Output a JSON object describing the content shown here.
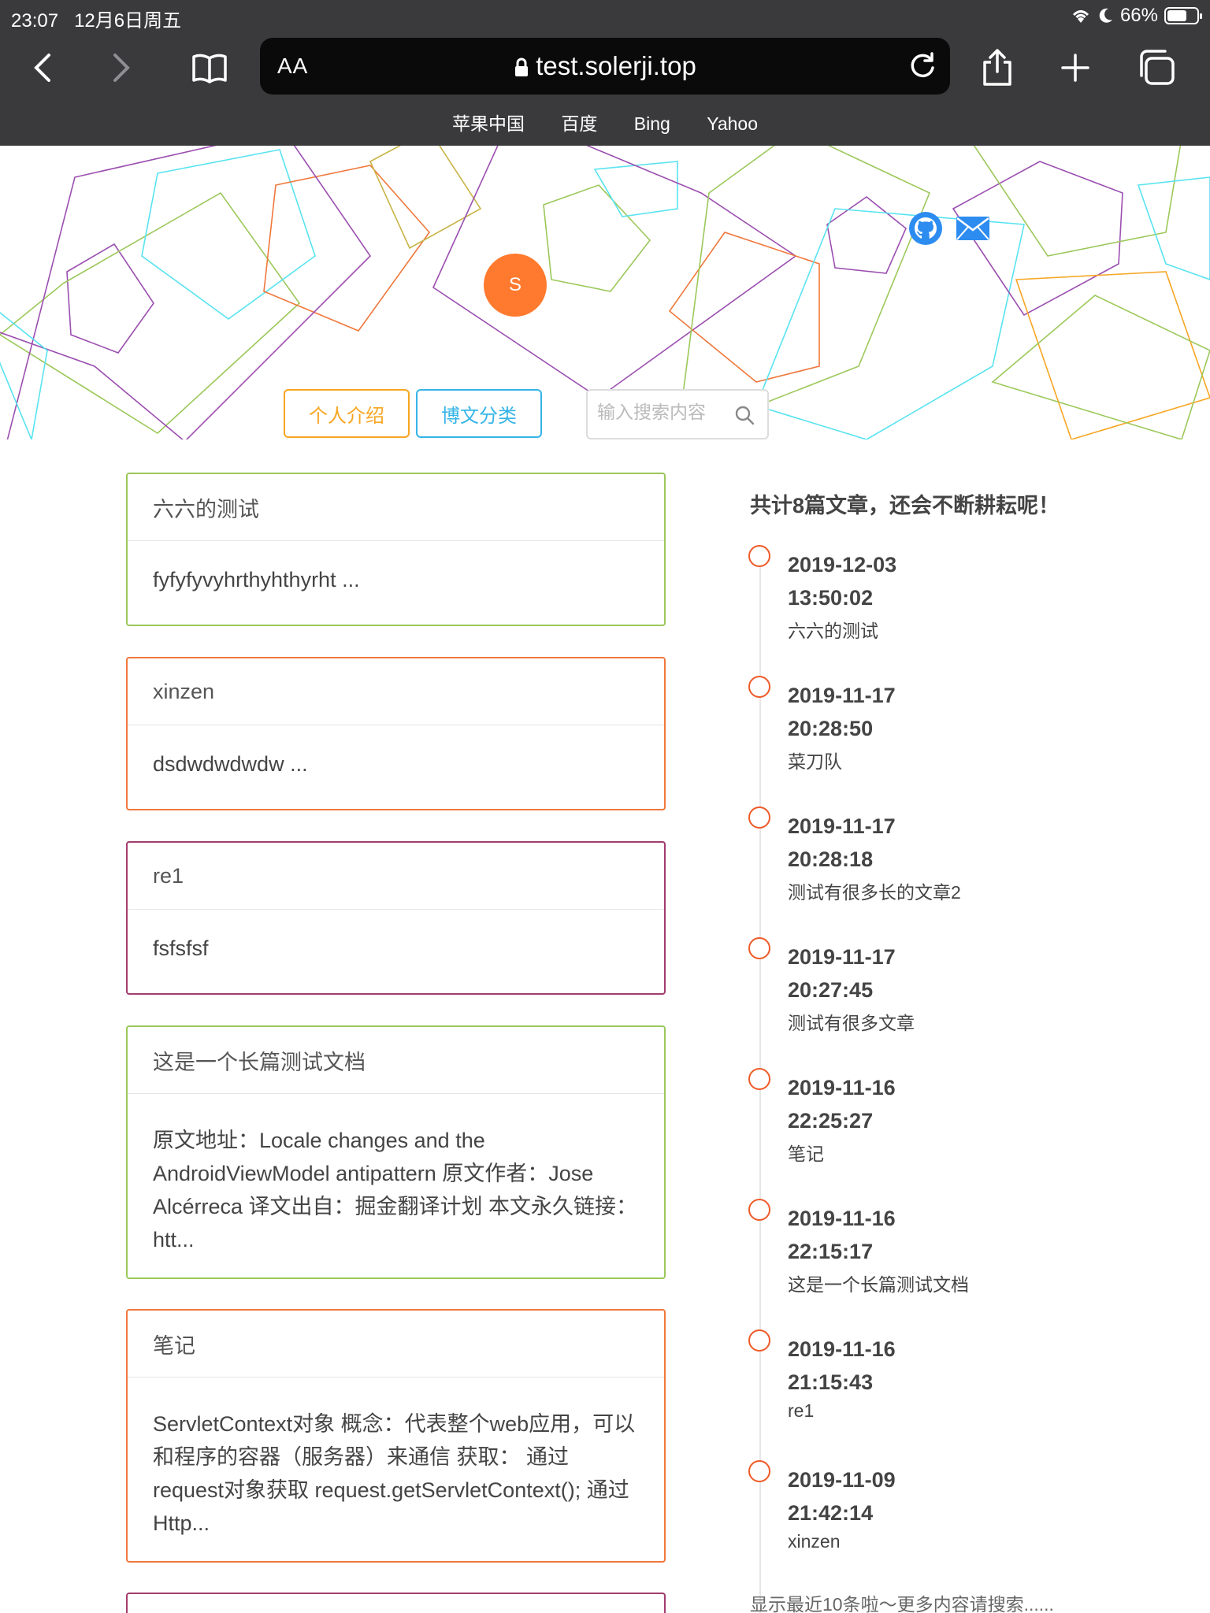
{
  "status": {
    "time": "23:07",
    "date": "12月6日周五",
    "battery": "66%",
    "battery_level": 0.66
  },
  "browser": {
    "text_size_label": "AA",
    "url": "test.solerji.top",
    "bookmarks": [
      "苹果中国",
      "百度",
      "Bing",
      "Yahoo"
    ]
  },
  "hero": {
    "avatar_letter": "S",
    "intro_button": "个人介绍",
    "category_button": "博文分类",
    "search_placeholder": "输入搜索内容"
  },
  "articles": [
    {
      "title": "六六的测试",
      "summary": "fyfyfyvyhrthyhthyrht ...",
      "color": "#9cc85a"
    },
    {
      "title": "xinzen",
      "summary": "dsdwdwdwdw ...",
      "color": "#f0783c"
    },
    {
      "title": "re1",
      "summary": "fsfsfsf",
      "color": "#a23c6e"
    },
    {
      "title": "这是一个长篇测试文档",
      "summary": "原文地址：Locale changes and the AndroidViewModel antipattern 原文作者：Jose Alcérreca 译文出自：掘金翻译计划 本文永久链接：htt...",
      "color": "#9cc85a"
    },
    {
      "title": "笔记",
      "summary": "ServletContext对象 概念：代表整个web应用，可以和程序的容器（服务器）来通信 获取： 通过request对象获取 request.getServletContext(); 通过Http...",
      "color": "#f0783c"
    }
  ],
  "timeline": {
    "heading": "共计8篇文章，还会不断耕耘呢！",
    "items": [
      {
        "date": "2019-12-03",
        "time": "13:50:02",
        "title": "六六的测试"
      },
      {
        "date": "2019-11-17",
        "time": "20:28:50",
        "title": "菜刀队"
      },
      {
        "date": "2019-11-17",
        "time": "20:28:18",
        "title": "测试有很多长的文章2"
      },
      {
        "date": "2019-11-17",
        "time": "20:27:45",
        "title": "测试有很多文章"
      },
      {
        "date": "2019-11-16",
        "time": "22:25:27",
        "title": "笔记"
      },
      {
        "date": "2019-11-16",
        "time": "22:15:17",
        "title": "这是一个长篇测试文档"
      },
      {
        "date": "2019-11-16",
        "time": "21:15:43",
        "title": "re1"
      },
      {
        "date": "2019-11-09",
        "time": "21:42:14",
        "title": "xinzen"
      }
    ],
    "more": "显示最近10条啦～更多内容请搜索......"
  }
}
